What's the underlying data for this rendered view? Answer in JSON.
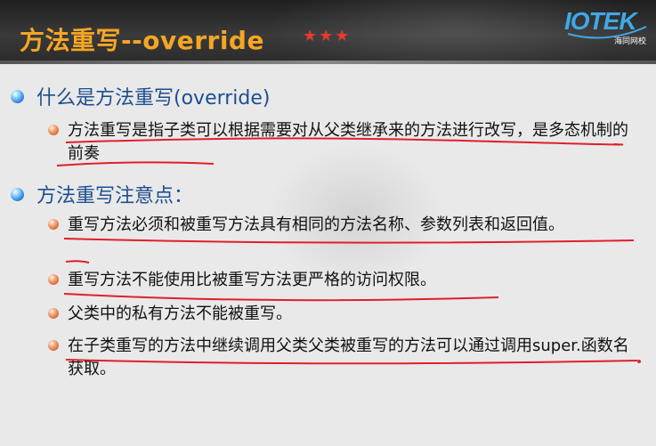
{
  "header": {
    "title": "方法重写--override",
    "stars": "★★★",
    "logo_text": "IOTEK",
    "logo_subtext": "海同网校"
  },
  "sections": [
    {
      "heading": "什么是方法重写(override)",
      "items": [
        "方法重写是指子类可以根据需要对从父类继承来的方法进行改写，是多态机制的前奏"
      ]
    },
    {
      "heading": "方法重写注意点：",
      "items": [
        "重写方法必须和被重写方法具有相同的方法名称、参数列表和返回值。",
        "重写方法不能使用比被重写方法更严格的访问权限。",
        "父类中的私有方法不能被重写。",
        "在子类重写的方法中继续调用父类父类被重写的方法可以通过调用super.函数名获取。"
      ]
    }
  ],
  "colors": {
    "title": "#f5a623",
    "stars": "#e53b2a",
    "heading": "#1d4f8f",
    "annotation": "#e0202a"
  }
}
